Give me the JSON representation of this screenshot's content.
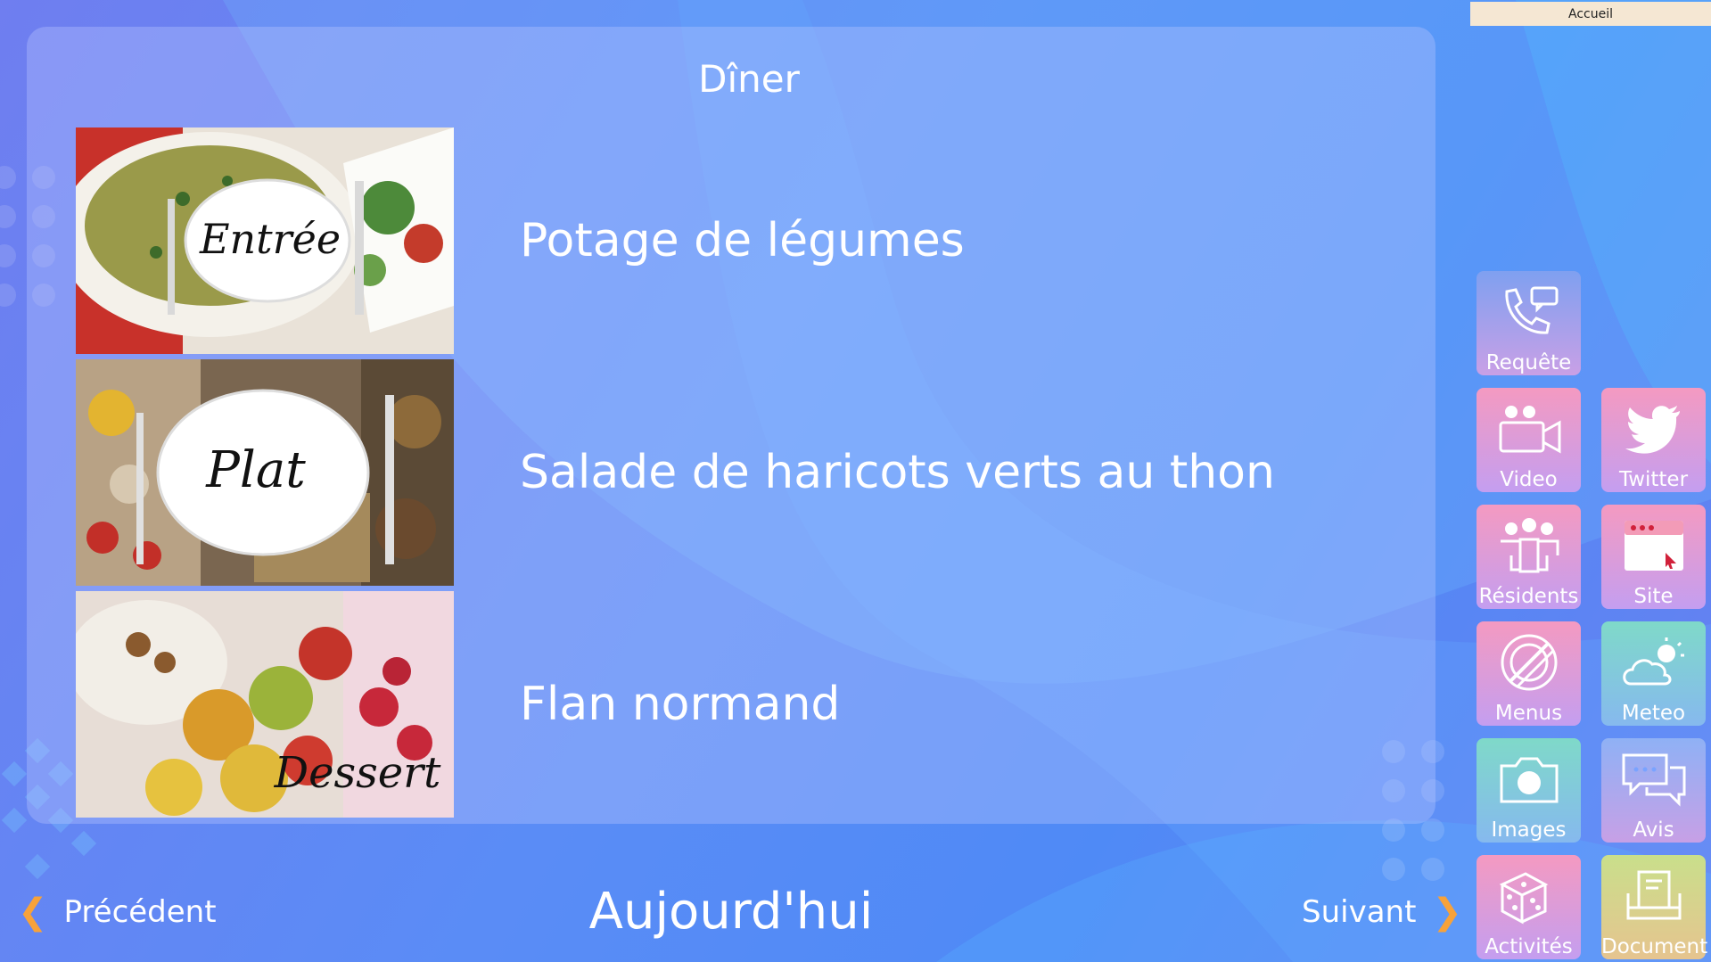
{
  "header": {
    "home_label": "Accueil"
  },
  "meal": {
    "title": "Dîner"
  },
  "courses": [
    {
      "badge": "Entrée",
      "dish": "Potage de légumes"
    },
    {
      "badge": "Plat",
      "dish": "Salade de haricots verts au thon"
    },
    {
      "badge": "Dessert",
      "dish": "Flan normand"
    }
  ],
  "navigation": {
    "previous": "Précédent",
    "today": "Aujourd'hui",
    "next": "Suivant"
  },
  "tiles": [
    {
      "label": "Requête",
      "icon": "phone-message-icon"
    },
    {
      "label": "Video",
      "icon": "video-camera-icon"
    },
    {
      "label": "Twitter",
      "icon": "twitter-bird-icon"
    },
    {
      "label": "Résidents",
      "icon": "people-icon"
    },
    {
      "label": "Site",
      "icon": "browser-window-icon"
    },
    {
      "label": "Menus",
      "icon": "plate-utensils-icon"
    },
    {
      "label": "Meteo",
      "icon": "weather-sun-cloud-icon"
    },
    {
      "label": "Images",
      "icon": "camera-icon"
    },
    {
      "label": "Avis",
      "icon": "chat-bubbles-icon"
    },
    {
      "label": "Activités",
      "icon": "dice-icon"
    },
    {
      "label": "Document",
      "icon": "document-tray-icon"
    }
  ],
  "colors": {
    "accent_arrow": "#f7a23a",
    "home_bar": "#f5e7d3"
  }
}
